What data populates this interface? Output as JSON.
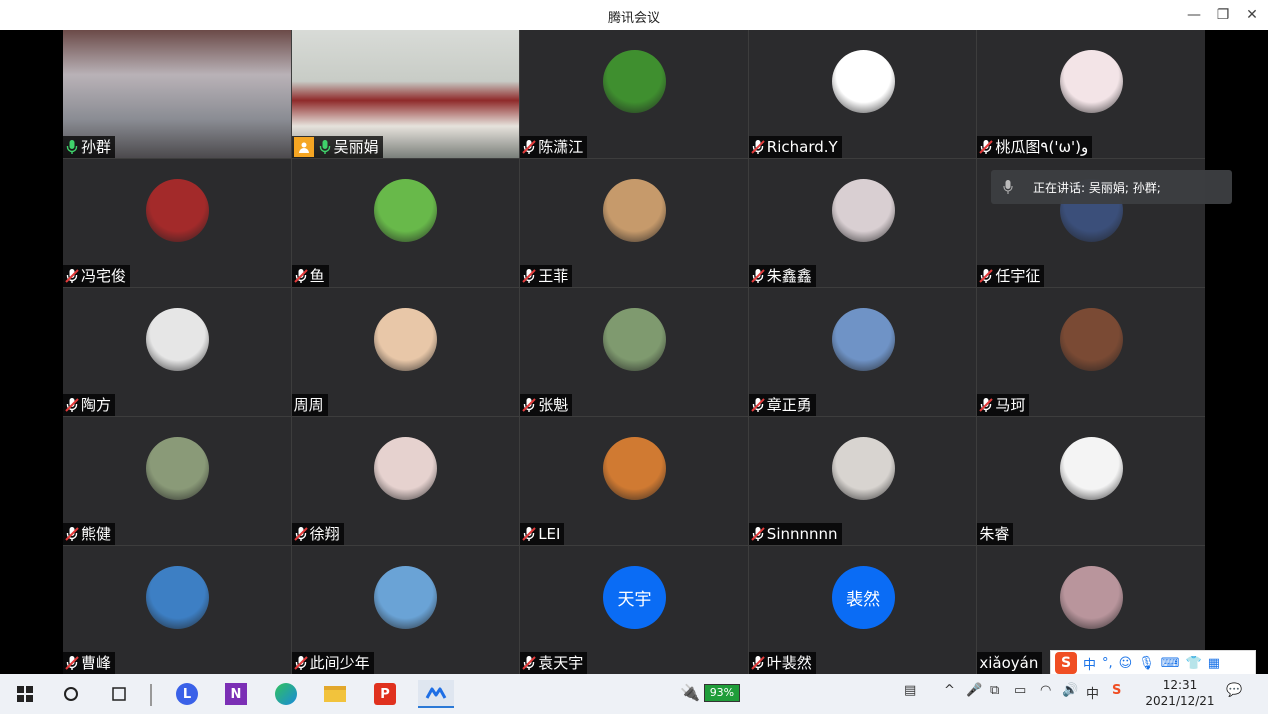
{
  "window": {
    "title": "腾讯会议",
    "minimize_glyph": "—",
    "restore_glyph": "❐",
    "close_glyph": "✕"
  },
  "speaking_popup": {
    "text": "正在讲话: 吴丽娟; 孙群;"
  },
  "participants": [
    {
      "name": "孙群",
      "mic": "on",
      "kind": "video"
    },
    {
      "name": "吴丽娟",
      "mic": "on",
      "kind": "video"
    },
    {
      "name": "陈潇江",
      "mic": "muted",
      "kind": "avatar",
      "color": "#3f8f2f"
    },
    {
      "name": "Richard.Y",
      "mic": "muted",
      "kind": "avatar",
      "color": "#ffffff"
    },
    {
      "name": "桃瓜图٩('ω')و",
      "mic": "muted",
      "kind": "avatar",
      "color": "#f3e4e7"
    },
    {
      "name": "冯宅俊",
      "mic": "muted",
      "kind": "avatar",
      "color": "#a32a2a"
    },
    {
      "name": "鱼",
      "mic": "muted",
      "kind": "avatar",
      "color": "#68b94a"
    },
    {
      "name": "王菲",
      "mic": "muted",
      "kind": "avatar",
      "color": "#c69a6b"
    },
    {
      "name": "朱鑫鑫",
      "mic": "muted",
      "kind": "avatar",
      "color": "#d9cfd2"
    },
    {
      "name": "任宇征",
      "mic": "muted",
      "kind": "avatar",
      "color": "#3b4f7a"
    },
    {
      "name": "陶方",
      "mic": "muted",
      "kind": "avatar",
      "color": "#e6e6e6"
    },
    {
      "name": "周周",
      "mic": "none",
      "kind": "avatar",
      "color": "#e8c7a8"
    },
    {
      "name": "张魁",
      "mic": "muted",
      "kind": "avatar",
      "color": "#7f9a6f"
    },
    {
      "name": "章正勇",
      "mic": "muted",
      "kind": "avatar",
      "color": "#6f93c6"
    },
    {
      "name": "马珂",
      "mic": "muted",
      "kind": "avatar",
      "color": "#7a4a34"
    },
    {
      "name": "熊健",
      "mic": "muted",
      "kind": "avatar",
      "color": "#8a9a78"
    },
    {
      "name": "徐翔",
      "mic": "muted",
      "kind": "avatar",
      "color": "#e6d2cf"
    },
    {
      "name": "LEI",
      "mic": "muted",
      "kind": "avatar",
      "color": "#d07a32"
    },
    {
      "name": "Sinnnnnn",
      "mic": "muted",
      "kind": "avatar",
      "color": "#d8d4d0"
    },
    {
      "name": "朱睿",
      "mic": "none",
      "kind": "avatar",
      "color": "#f4f4f4"
    },
    {
      "name": "曹峰",
      "mic": "muted",
      "kind": "avatar",
      "color": "#3d7fc4"
    },
    {
      "name": "此间少年",
      "mic": "muted",
      "kind": "avatar",
      "color": "#6aa3d6"
    },
    {
      "name": "袁天宇",
      "mic": "muted",
      "kind": "text-avatar",
      "avatar_text": "天宇"
    },
    {
      "name": "叶裴然",
      "mic": "muted",
      "kind": "text-avatar",
      "avatar_text": "裴然"
    },
    {
      "name": "xiǎoyán",
      "mic": "none",
      "kind": "avatar",
      "color": "#b9959c"
    }
  ],
  "ime_toolbar": {
    "mode": "中",
    "punct": "°,",
    "logo": "S"
  },
  "taskbar": {
    "battery_percent": "93%",
    "ime_lang": "中",
    "time": "12:31",
    "date": "2021/12/21"
  }
}
